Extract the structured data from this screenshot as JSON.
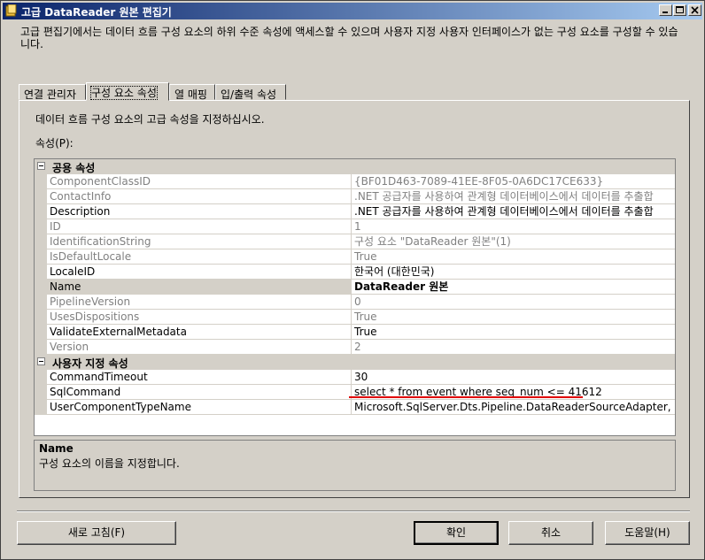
{
  "window": {
    "title": "고급 DataReader 원본 편집기"
  },
  "description": "고급 편집기에서는 데이터 흐름 구성 요소의 하위 수준 속성에 액세스할 수 있으며 사용자 지정 사용자 인터페이스가 없는 구성 요소를 구성할 수 있습니다.",
  "tabs": [
    {
      "label": "연결 관리자"
    },
    {
      "label": "구성 요소 속성"
    },
    {
      "label": "열 매핑"
    },
    {
      "label": "입/출력 속성"
    }
  ],
  "panel": {
    "instruction": "데이터 흐름 구성 요소의 고급 속성을 지정하십시오.",
    "properties_label": "속성(P):"
  },
  "grid": {
    "common_category": "공용 속성",
    "custom_category": "사용자 지정 속성",
    "common": [
      {
        "name": "ComponentClassID",
        "value": "{BF01D463-7089-41EE-8F05-0A6DC17CE633}"
      },
      {
        "name": "ContactInfo",
        "value": ".NET 공급자를 사용하여 관계형 데이터베이스에서 데이터를 추출합"
      },
      {
        "name": "Description",
        "value": ".NET 공급자를 사용하여 관계형 데이터베이스에서 데이터를 추출합"
      },
      {
        "name": "ID",
        "value": "1"
      },
      {
        "name": "IdentificationString",
        "value": "구성 요소 \"DataReader 원본\"(1)"
      },
      {
        "name": "IsDefaultLocale",
        "value": "True"
      },
      {
        "name": "LocaleID",
        "value": "한국어 (대한민국)"
      },
      {
        "name": "Name",
        "value": "DataReader 원본"
      },
      {
        "name": "PipelineVersion",
        "value": "0"
      },
      {
        "name": "UsesDispositions",
        "value": "True"
      },
      {
        "name": "ValidateExternalMetadata",
        "value": "True"
      },
      {
        "name": "Version",
        "value": "2"
      }
    ],
    "custom": [
      {
        "name": "CommandTimeout",
        "value": "30"
      },
      {
        "name": "SqlCommand",
        "value": "select * from event where seq_num <= 41612"
      },
      {
        "name": "UserComponentTypeName",
        "value": "Microsoft.SqlServer.Dts.Pipeline.DataReaderSourceAdapter, Micr"
      }
    ]
  },
  "help": {
    "title": "Name",
    "text": "구성 요소의 이름을 지정합니다."
  },
  "buttons": {
    "refresh": "새로 고침(F)",
    "ok": "확인",
    "cancel": "취소",
    "help": "도움말(H)"
  }
}
